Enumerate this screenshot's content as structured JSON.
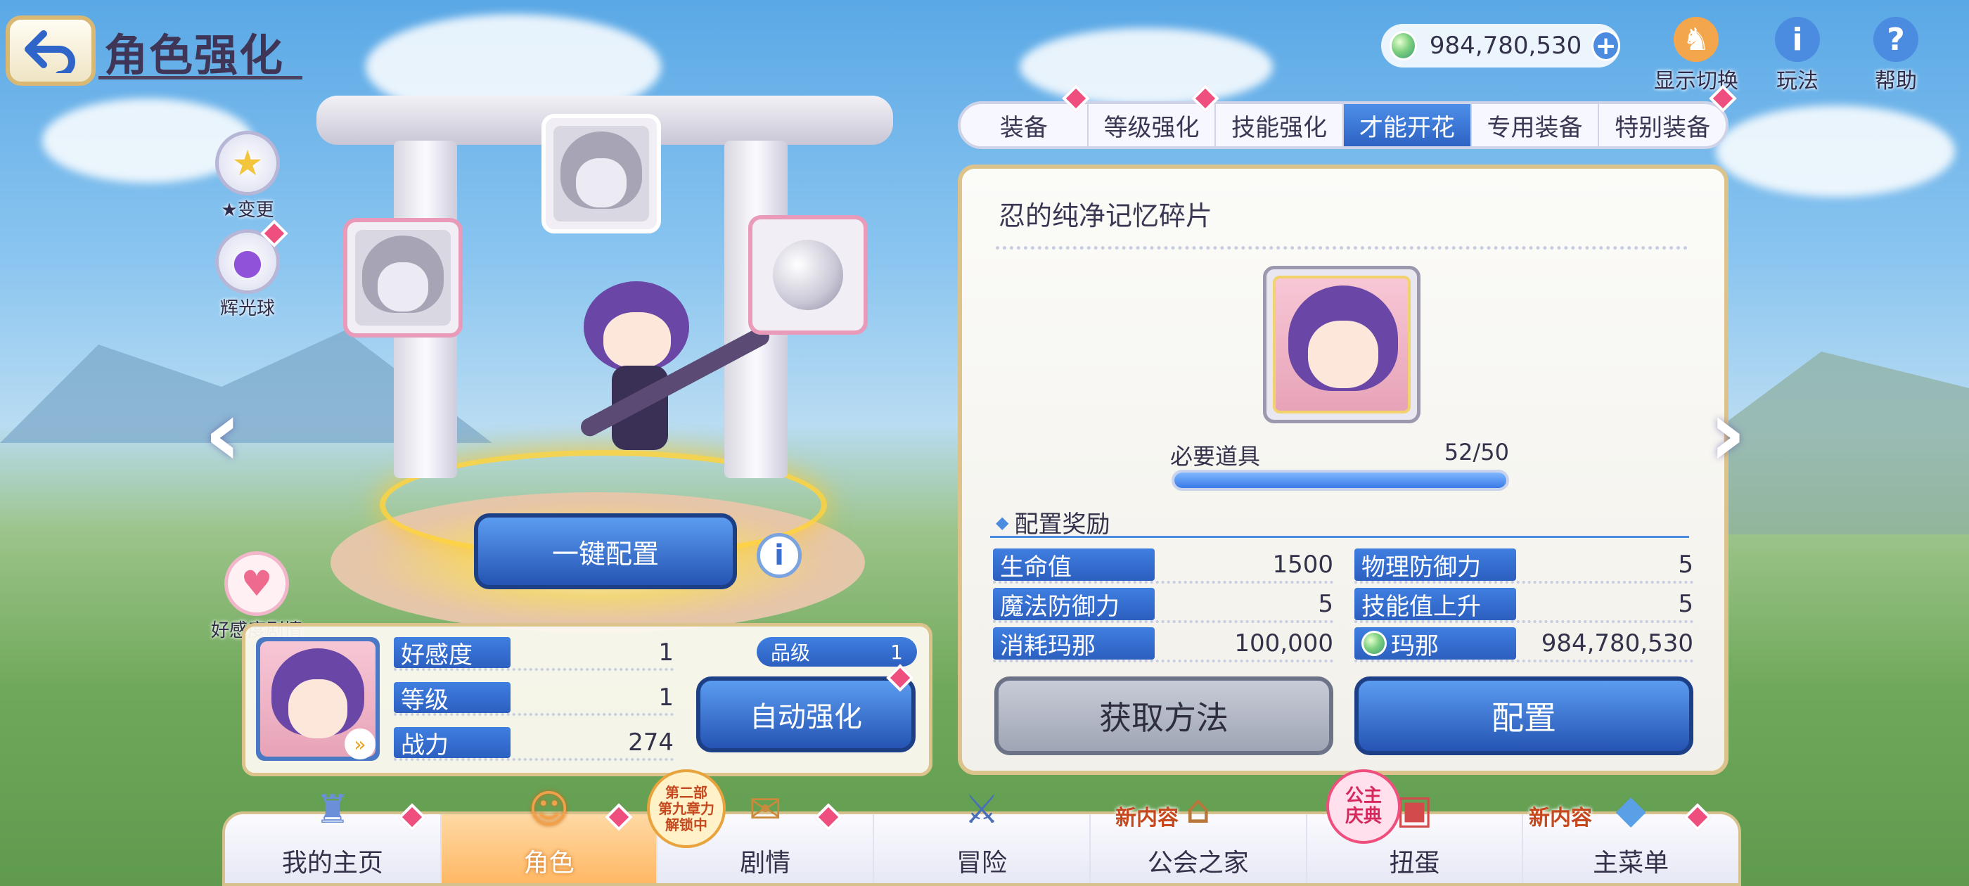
{
  "header": {
    "title": "角色强化",
    "mana_amount": "984,780,530",
    "icons": [
      {
        "name": "display-toggle",
        "label": "显示切换",
        "icon": "person-swap-icon"
      },
      {
        "name": "gameplay",
        "label": "玩法",
        "icon": "info-icon"
      },
      {
        "name": "help",
        "label": "帮助",
        "icon": "question-icon"
      }
    ]
  },
  "tabs": [
    {
      "label": "装备",
      "badge": true
    },
    {
      "label": "等级强化",
      "badge": true
    },
    {
      "label": "技能强化",
      "badge": false
    },
    {
      "label": "才能开花",
      "badge": false,
      "active": true
    },
    {
      "label": "专用装备",
      "badge": false
    },
    {
      "label": "特别装备",
      "badge": true
    }
  ],
  "panel": {
    "item_title": "忍的纯净记忆碎片",
    "required_label": "必要道具",
    "required_count": "52/50",
    "progress_fraction": 1.0,
    "reward_heading": "配置奖励",
    "stats_left": [
      {
        "label": "生命值",
        "value": "1500"
      },
      {
        "label": "魔法防御力",
        "value": "5"
      },
      {
        "label": "消耗玛那",
        "value": "100,000"
      }
    ],
    "stats_right": [
      {
        "label": "物理防御力",
        "value": "5"
      },
      {
        "label": "技能值上升",
        "value": "5"
      },
      {
        "label": "玛那",
        "value": "984,780,530"
      }
    ],
    "obtain_button": "获取方法",
    "configure_button": "配置"
  },
  "left": {
    "star_change_label": "★变更",
    "glow_orb_label": "辉光球",
    "one_click_button": "一键配置",
    "affection_story_label": "好感度剧情",
    "affection_label": "好感度",
    "affection_value": "1",
    "level_label": "等级",
    "level_value": "1",
    "power_label": "战力",
    "power_value": "274",
    "rank_label": "品级",
    "rank_value": "1",
    "auto_enhance_button": "自动强化"
  },
  "bottom_nav": {
    "items": [
      {
        "label": "我的主页",
        "icon": "castle-icon",
        "badge": true
      },
      {
        "label": "角色",
        "icon": "character-icon",
        "badge": true,
        "active": true
      },
      {
        "label": "剧情",
        "icon": "scroll-icon",
        "badge": true,
        "tag": "第二部第九章力解锁中"
      },
      {
        "label": "冒险",
        "icon": "sword-flag-icon",
        "badge": false
      },
      {
        "label": "公会之家",
        "icon": "guild-house-icon",
        "badge": false,
        "tag": "新内容"
      },
      {
        "label": "扭蛋",
        "icon": "gacha-icon",
        "badge": false,
        "tag": "公主庆典"
      },
      {
        "label": "主菜单",
        "icon": "crystal-icon",
        "badge": true,
        "tag": "新内容"
      }
    ],
    "story_tag_line1": "第二部",
    "story_tag_line2": "第九章力",
    "story_tag_line3": "解锁中",
    "new_content_tag": "新内容",
    "princess_fes_line1": "公主",
    "princess_fes_line2": "庆典"
  },
  "colors": {
    "accent_blue": "#2e63c4",
    "badge_pink": "#ef4f7e",
    "frame_gold": "#dcc38c"
  }
}
